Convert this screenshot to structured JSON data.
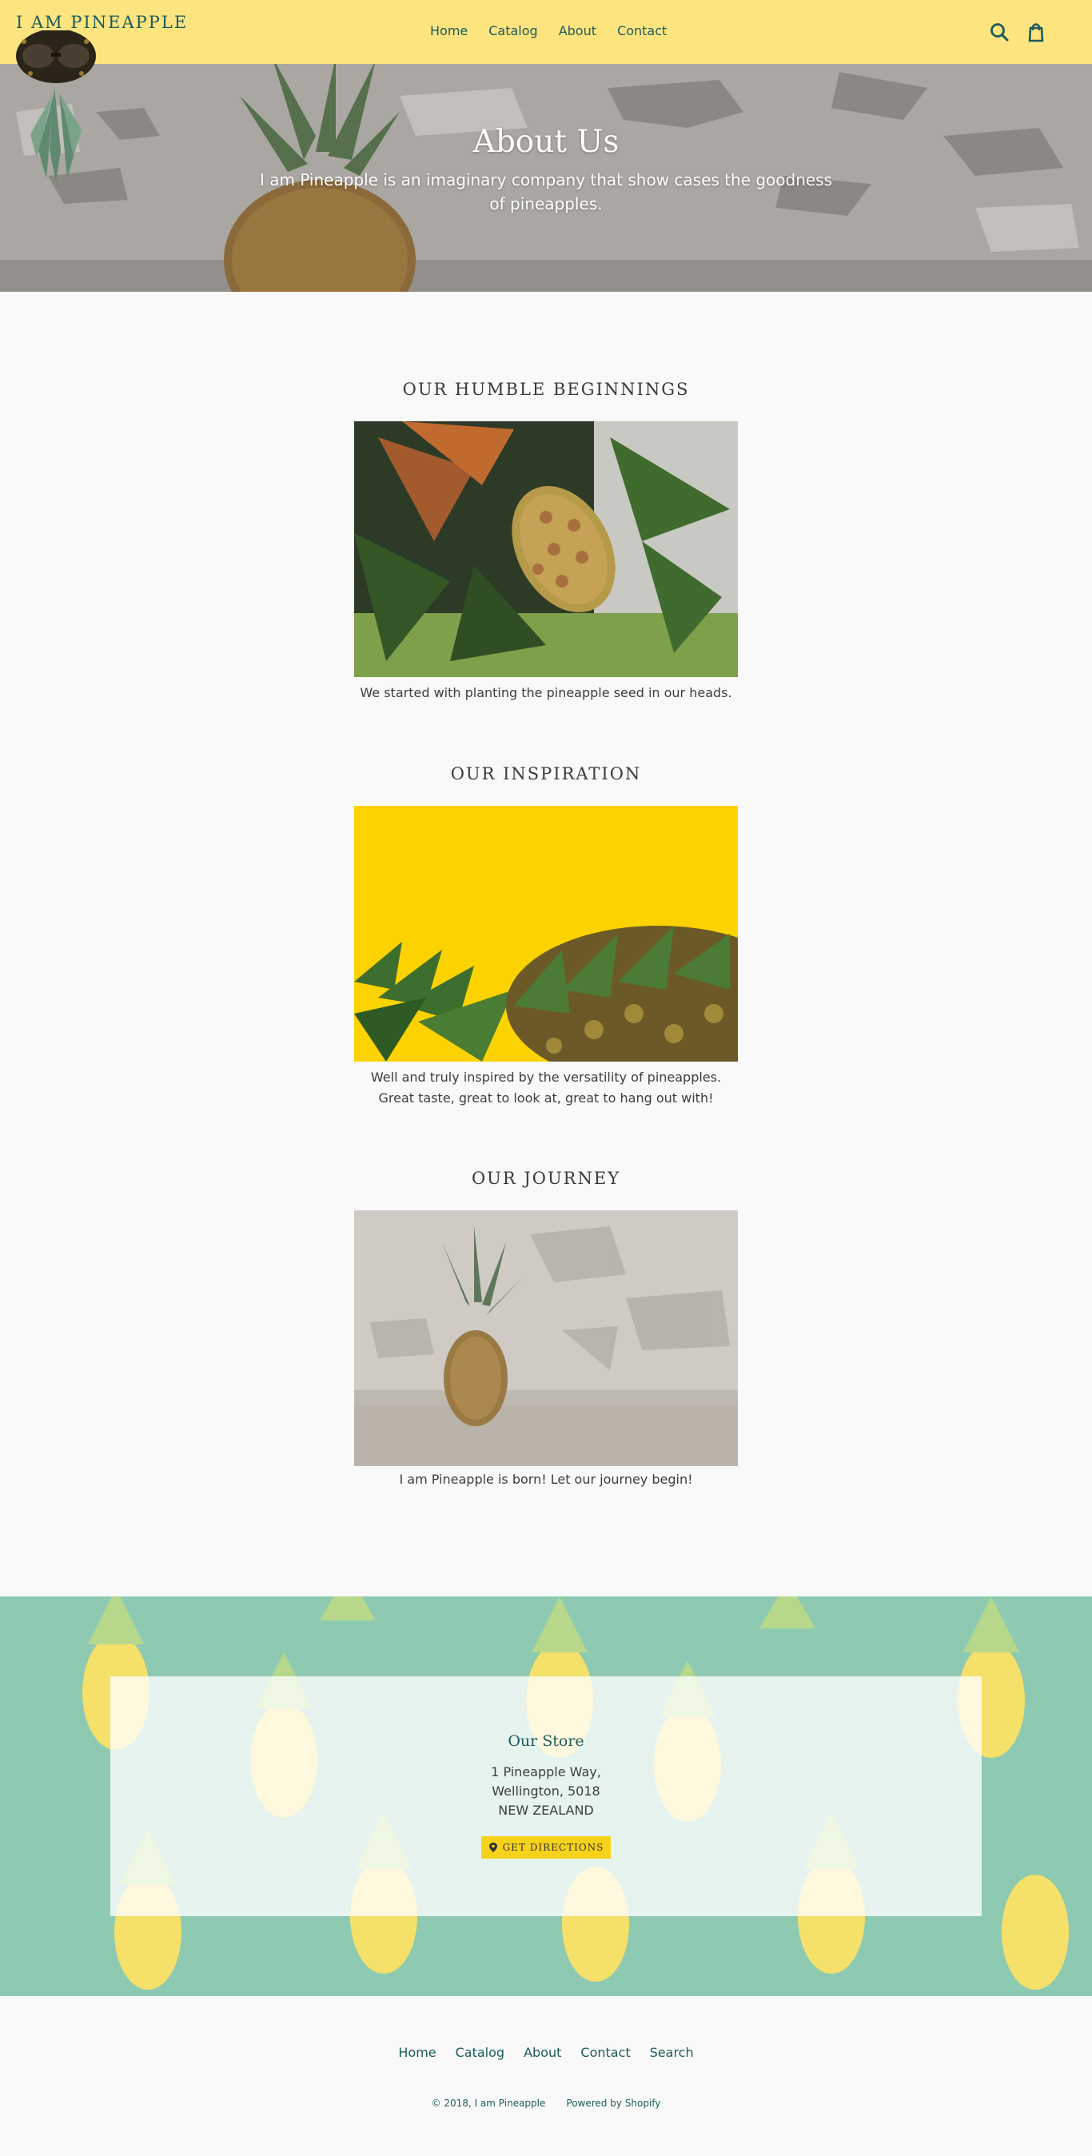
{
  "header": {
    "logo_text": "I AM PINEAPPLE",
    "nav": [
      "Home",
      "Catalog",
      "About",
      "Contact"
    ],
    "search_icon": "search-icon",
    "cart_icon": "cart-icon"
  },
  "hero": {
    "title": "About Us",
    "subtitle": "I am Pineapple is an imaginary company that show cases the goodness of pineapples."
  },
  "sections": [
    {
      "title": "OUR HUMBLE BEGINNINGS",
      "caption": [
        "We started with planting the pineapple seed in our heads."
      ]
    },
    {
      "title": "OUR INSPIRATION",
      "caption": [
        "Well and truly inspired by the versatility of pineapples.",
        "Great taste, great to look at, great to hang out with!"
      ]
    },
    {
      "title": "OUR JOURNEY",
      "caption": [
        "I am Pineapple is born! Let our journey begin!"
      ]
    }
  ],
  "store": {
    "title": "Our Store",
    "address": [
      "1 Pineapple Way,",
      "Wellington, 5018",
      "NEW ZEALAND"
    ],
    "button": "GET DIRECTIONS"
  },
  "footer": {
    "nav": [
      "Home",
      "Catalog",
      "About",
      "Contact",
      "Search"
    ],
    "copyright": "© 2018, I am Pineapple",
    "powered": "Powered by Shopify"
  },
  "colors": {
    "header_bg": "#fde47f",
    "brand_teal": "#1c5b5b",
    "store_bg": "#8ecab2",
    "button_yellow": "#f7d21b"
  }
}
